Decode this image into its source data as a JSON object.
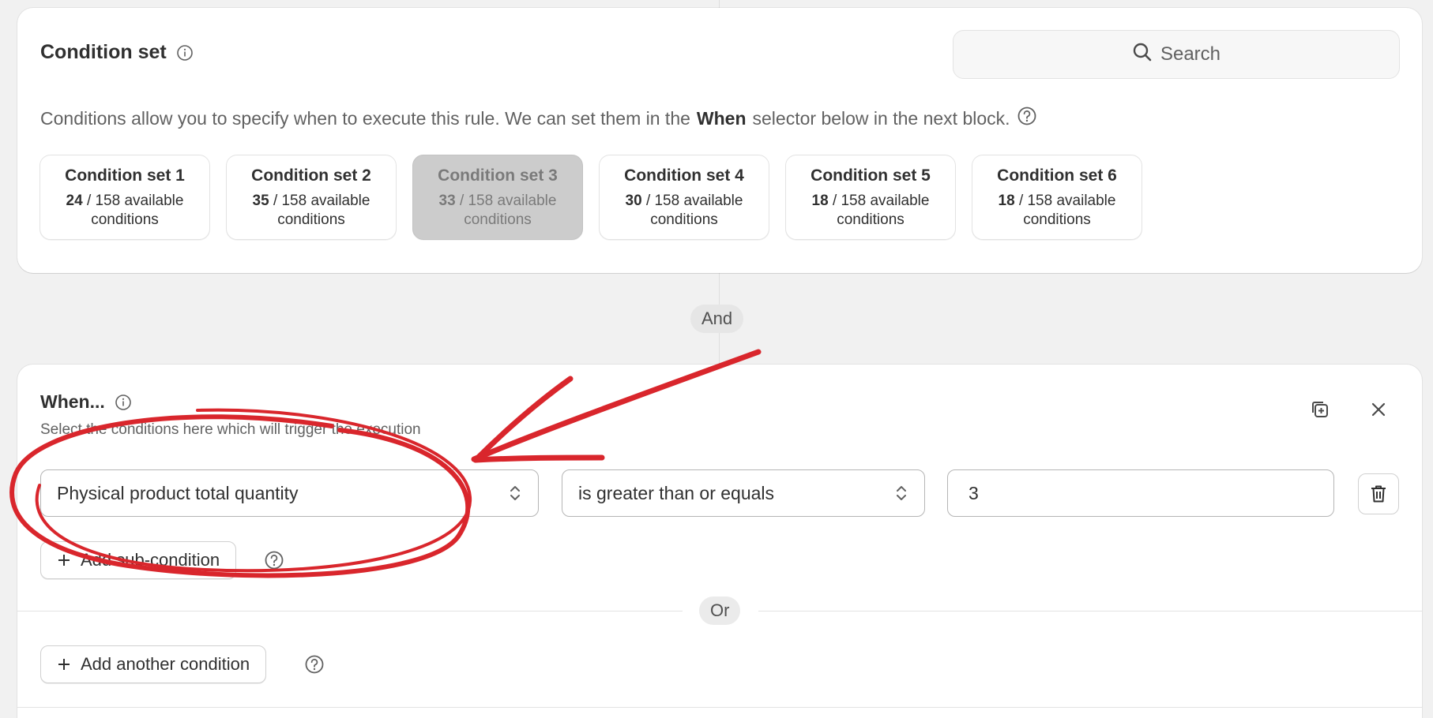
{
  "condition_set": {
    "title": "Condition set",
    "search_label": "Search",
    "description_prefix": "Conditions allow you to specify when to execute this rule. We can set them in the",
    "description_bold": "When",
    "description_suffix": "selector below in the next block.",
    "sets": [
      {
        "name": "Condition set 1",
        "count": "24",
        "of": "/ 158 available",
        "unit": "conditions",
        "active": false
      },
      {
        "name": "Condition set 2",
        "count": "35",
        "of": "/ 158 available",
        "unit": "conditions",
        "active": false
      },
      {
        "name": "Condition set 3",
        "count": "33",
        "of": "/ 158 available",
        "unit": "conditions",
        "active": true
      },
      {
        "name": "Condition set 4",
        "count": "30",
        "of": "/ 158 available",
        "unit": "conditions",
        "active": false
      },
      {
        "name": "Condition set 5",
        "count": "18",
        "of": "/ 158 available",
        "unit": "conditions",
        "active": false
      },
      {
        "name": "Condition set 6",
        "count": "18",
        "of": "/ 158 available",
        "unit": "conditions",
        "active": false
      }
    ]
  },
  "connector_and": "And",
  "when": {
    "title": "When...",
    "subtitle": "Select the conditions here which will trigger the execution",
    "field_value": "Physical product total quantity",
    "operator_value": "is greater than or equals",
    "input_value": "3",
    "add_sub_label": "Add sub-condition",
    "or_label": "Or",
    "add_another_label": "Add another condition"
  },
  "colors": {
    "annotation": "#d9262c",
    "active_set_bg": "#cccccc",
    "page_bg": "#f1f1f1"
  }
}
